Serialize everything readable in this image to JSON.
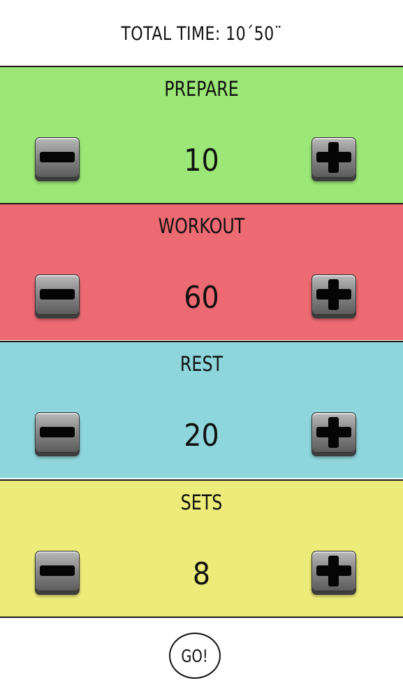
{
  "header": {
    "total_time": "TOTAL TIME: 10´50¨"
  },
  "colors": {
    "prepare": "#9ce777",
    "workout": "#ec6a72",
    "rest": "#8ed6dc",
    "sets": "#edec7a"
  },
  "sections": [
    {
      "title": "PREPARE",
      "value": "10",
      "color": "#9ce777"
    },
    {
      "title": "WORKOUT",
      "value": "60",
      "color": "#ec6a72"
    },
    {
      "title": "REST",
      "value": "20",
      "color": "#8ed6dc"
    },
    {
      "title": "SETS",
      "value": "8",
      "color": "#edec7a"
    }
  ],
  "footer": {
    "go_label": "GO!"
  },
  "icons": {
    "decrement": "minus-icon",
    "increment": "plus-icon"
  }
}
